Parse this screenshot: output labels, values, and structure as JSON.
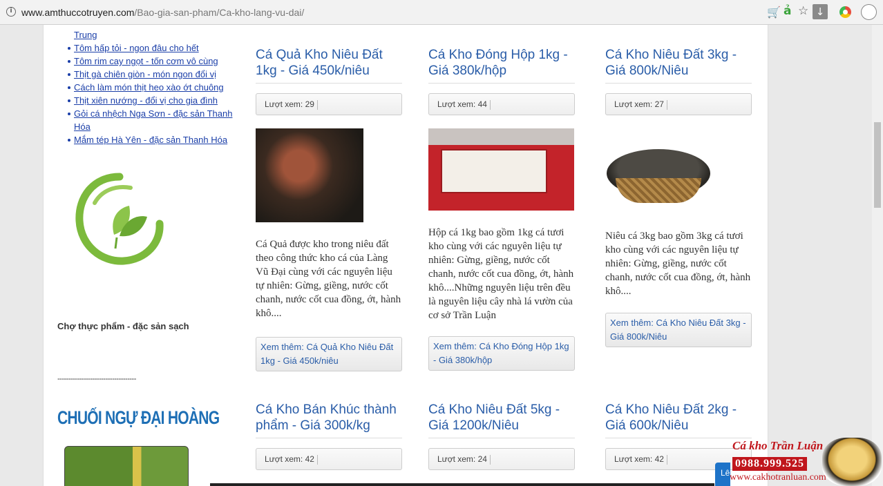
{
  "browser": {
    "url_domain": "www.amthuccotruyen.com",
    "url_path": "/Bao-gia-san-pham/Ca-kho-lang-vu-dai/",
    "icons": [
      "info-icon",
      "cart-icon",
      "translate-icon",
      "star-icon",
      "download-icon",
      "extension-icon",
      "profile-icon"
    ]
  },
  "sidebar": {
    "links": [
      {
        "label": "Trung",
        "continuation": true
      },
      {
        "label": "Tôm hấp tỏi - ngon đâu cho hết"
      },
      {
        "label": "Tôm rim cay ngọt - tốn cơm vô cùng"
      },
      {
        "label": "Thịt gà chiên giòn - món ngon đổi vị"
      },
      {
        "label": "Cách làm món thịt heo xào ớt chuông"
      },
      {
        "label": "Thịt xiên nướng - đổi vị cho gia đình"
      },
      {
        "label": "Gỏi cá nhệch Nga Sơn - đặc sản Thanh"
      },
      {
        "label": "Hóa",
        "continuation": true
      },
      {
        "label": "Mắm tép Hà Yên - đặc sản Thanh Hóa"
      }
    ],
    "market_title": "Chợ thực phẩm - đặc sản sạch",
    "divider": "------------------------------------",
    "banana_title": "CHUỐI NGỰ ĐẠI HOÀNG"
  },
  "products": [
    {
      "title": "Cá Quả Kho Niêu Đất 1kg - Giá 450k/niêu",
      "views": "Lượt xem: 29",
      "desc": "Cá Quả được kho trong niêu đất theo công thức kho cá của Làng Vũ Đại cùng với các nguyên liệu tự nhiên: Gừng, giềng, nước cốt chanh, nước cốt cua đồng, ớt, hành khô....",
      "more": "Xem thêm: Cá Quả Kho Niêu Đất 1kg - Giá 450k/niêu"
    },
    {
      "title": "Cá Kho Đóng Hộp 1kg - Giá 380k/hộp",
      "views": "Lượt xem: 44",
      "desc": "Hộp cá 1kg bao gồm 1kg cá tươi kho cùng với các nguyên liệu tự nhiên: Gừng, giềng, nước cốt chanh, nước cốt cua đồng, ớt, hành khô....Những nguyên liệu trên đều là nguyên liệu cây nhà lá vườn của cơ sở Trần Luận",
      "more": "Xem thêm: Cá Kho Đóng Hộp 1kg - Giá 380k/hộp"
    },
    {
      "title": "Cá Kho Niêu Đất 3kg - Giá 800k/Niêu",
      "views": "Lượt xem: 27",
      "desc": "Niêu cá 3kg bao gồm 3kg cá tươi kho cùng với các nguyên liệu tự nhiên: Gừng, giềng, nước cốt chanh, nước cốt cua đồng, ớt, hành khô....",
      "more": "Xem thêm: Cá Kho Niêu Đất 3kg - Giá 800k/Niêu"
    },
    {
      "title": "Cá Kho Bán Khúc thành phẩm - Giá 300k/kg",
      "views": "Lượt xem: 42"
    },
    {
      "title": "Cá Kho Niêu Đất 5kg - Giá 1200k/Niêu",
      "views": "Lượt xem: 24"
    },
    {
      "title": "Cá Kho Niêu Đất 2kg - Giá 600k/Niêu",
      "views": "Lượt xem: 42"
    }
  ],
  "watermark": {
    "name": "Cá kho Trần Luận",
    "phone": "0988.999.525",
    "site": "www.cakhotranluan.com"
  },
  "floating_button": "Lê"
}
